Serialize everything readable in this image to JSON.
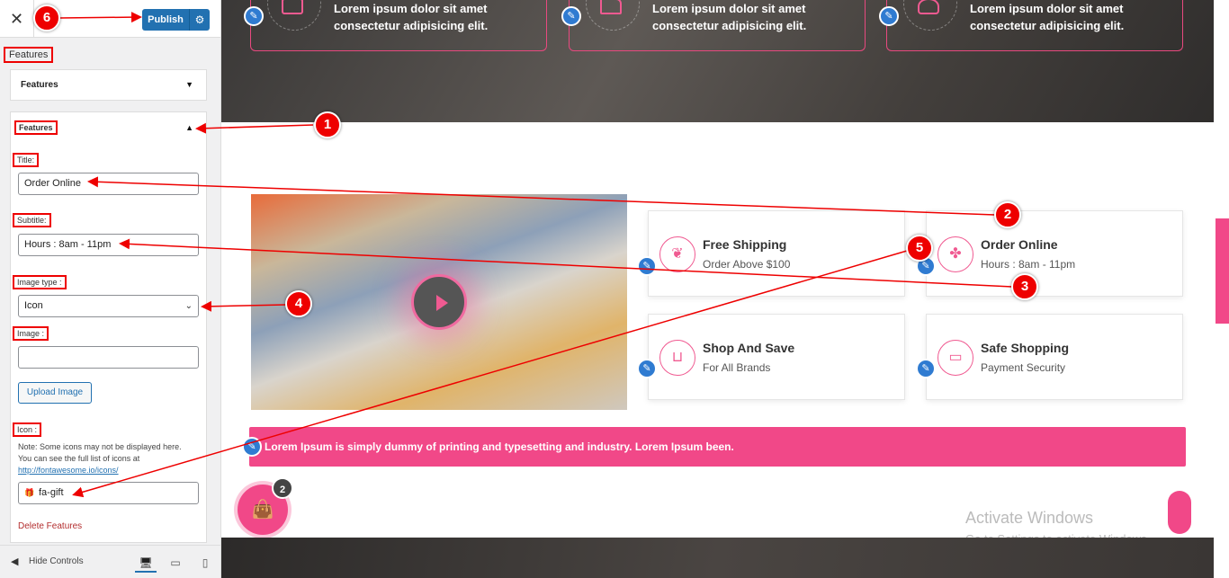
{
  "sidebar": {
    "close_glyph": "✕",
    "publish_label": "Publish",
    "breadcrumb": "Features",
    "collapsed_panel_title": "Features",
    "open_panel_title": "Features",
    "title_label": "Title:",
    "title_value": "Order Online",
    "subtitle_label": "Subtitle:",
    "subtitle_value": "Hours : 8am - 11pm",
    "image_type_label": "Image type :",
    "image_type_value": "Icon",
    "image_label": "Image :",
    "image_value": "",
    "upload_label": "Upload Image",
    "icon_label": "Icon :",
    "icon_note_line1": "Note: Some icons may not be displayed here.",
    "icon_note_line2": "You can see the full list of icons at",
    "icon_note_link": "http://fontawesome.io/icons/",
    "icon_value": "fa-gift",
    "delete_label": "Delete Features",
    "hide_controls_label": "Hide Controls"
  },
  "hero_cards": [
    {
      "line1": "Lorem ipsum dolor sit amet",
      "line2": "consectetur adipisicing elit."
    },
    {
      "line1": "Lorem ipsum dolor sit amet",
      "line2": "consectetur adipisicing elit."
    },
    {
      "line1": "Lorem ipsum dolor sit amet",
      "line2": "consectetur adipisicing elit."
    }
  ],
  "features": [
    {
      "title": "Free Shipping",
      "subtitle": "Order Above $100",
      "icon": "leaf-icon"
    },
    {
      "title": "Order Online",
      "subtitle": "Hours : 8am - 11pm",
      "icon": "gift-icon"
    },
    {
      "title": "Shop And Save",
      "subtitle": "For All Brands",
      "icon": "basket-icon"
    },
    {
      "title": "Safe Shopping",
      "subtitle": "Payment Security",
      "icon": "credit-card-icon"
    }
  ],
  "banner_text": "Lorem Ipsum is simply dummy of printing and typesetting and industry. Lorem Ipsum been.",
  "cart_count": "2",
  "watermark": {
    "line1": "Activate Windows",
    "line2": "Go to Settings to activate Windows."
  },
  "markers": [
    "1",
    "2",
    "3",
    "4",
    "5",
    "6"
  ],
  "colors": {
    "accent_pink": "#f14888",
    "wp_blue": "#2271b1",
    "annotation_red": "#ee0000"
  }
}
